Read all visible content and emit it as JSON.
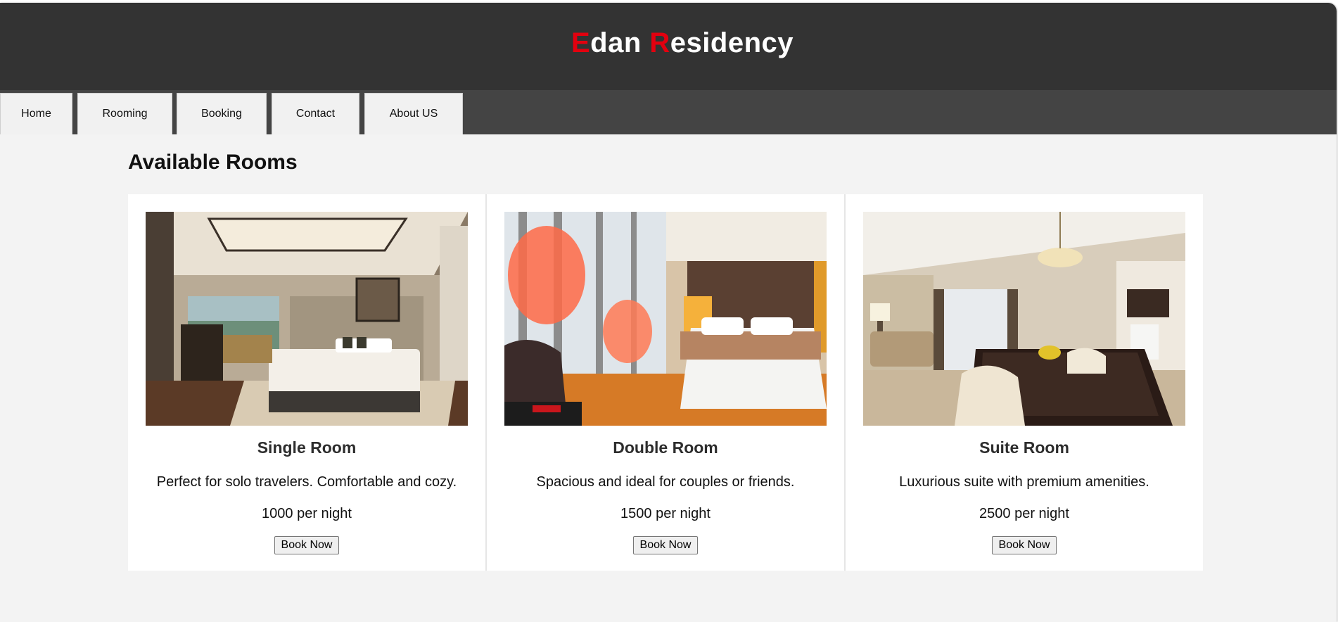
{
  "brand": {
    "first_initial": "E",
    "first_rest": "dan ",
    "second_initial": "R",
    "second_rest": "esidency"
  },
  "nav": {
    "items": [
      "Home",
      "Rooming",
      "Booking",
      "Contact",
      "About US"
    ]
  },
  "main": {
    "title": "Available Rooms"
  },
  "rooms": [
    {
      "name": "Single Room",
      "description": "Perfect for solo travelers. Comfortable and cozy.",
      "price": "1000 per night",
      "button": "Book Now"
    },
    {
      "name": "Double Room",
      "description": "Spacious and ideal for couples or friends.",
      "price": "1500 per night",
      "button": "Book Now"
    },
    {
      "name": "Suite Room",
      "description": "Luxurious suite with premium amenities.",
      "price": "2500 per night",
      "button": "Book Now"
    }
  ],
  "colors": {
    "header_bg": "#333333",
    "nav_bg": "#444444",
    "accent": "#e3000f",
    "page_bg": "#f3f3f3"
  }
}
